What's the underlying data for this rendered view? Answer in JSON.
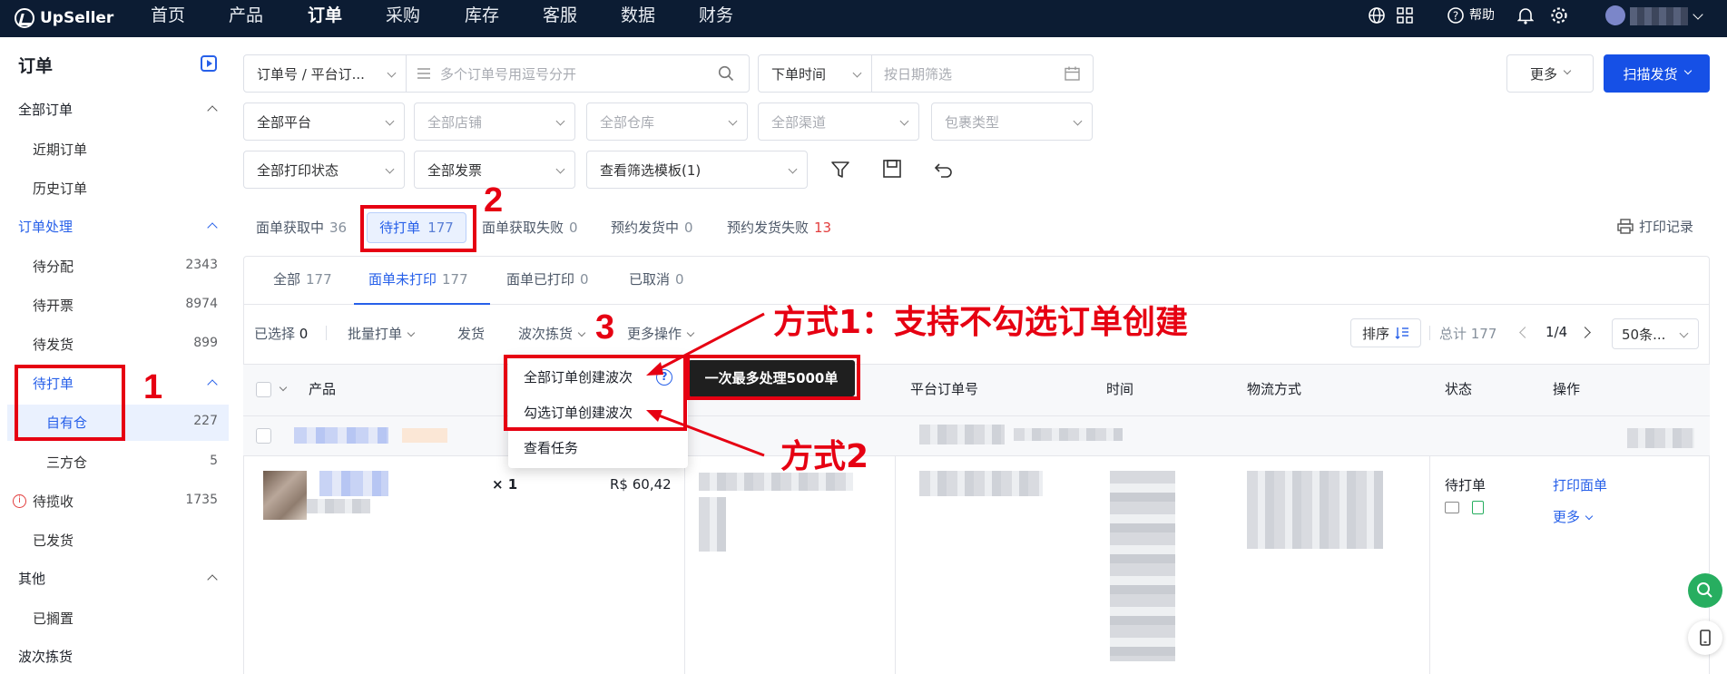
{
  "topnav": {
    "brand": "UpSeller",
    "items": [
      "首页",
      "产品",
      "订单",
      "采购",
      "库存",
      "客服",
      "数据",
      "财务"
    ],
    "help": "帮助"
  },
  "sidebar": {
    "title": "订单",
    "all_orders": "全部订单",
    "recent_orders": "近期订单",
    "history_orders": "历史订单",
    "processing": "订单处理",
    "to_allocate": {
      "label": "待分配",
      "count": "2343"
    },
    "to_invoice": {
      "label": "待开票",
      "count": "8974"
    },
    "to_ship": {
      "label": "待发货",
      "count": "899"
    },
    "to_print": "待打单",
    "own_warehouse": {
      "label": "自有仓",
      "count": "227"
    },
    "third_party": {
      "label": "三方仓",
      "count": "5"
    },
    "to_collect": {
      "label": "待揽收",
      "count": "1735"
    },
    "shipped": "已发货",
    "other": "其他",
    "shelved": "已搁置",
    "wave_picking": "波次拣货"
  },
  "filters": {
    "order_no_select": "订单号 / 平台订...",
    "order_no_placeholder": "多个订单号用逗号分开",
    "time_select": "下单时间",
    "date_placeholder": "按日期筛选",
    "more": "更多",
    "scan_ship": "扫描发货",
    "platform": "全部平台",
    "store": "全部店铺",
    "warehouse": "全部仓库",
    "channel": "全部渠道",
    "package_type": "包裹类型",
    "print_status": "全部打印状态",
    "invoice": "全部发票",
    "filter_template": "查看筛选模板(1)"
  },
  "status_tabs": [
    {
      "label": "面单获取中",
      "count": "36"
    },
    {
      "label": "待打单",
      "count": "177"
    },
    {
      "label": "面单获取失败",
      "count": "0"
    },
    {
      "label": "预约发货中",
      "count": "0"
    },
    {
      "label": "预约发货失败",
      "count": "13"
    }
  ],
  "print_record": "打印记录",
  "sub_tabs": [
    {
      "label": "全部",
      "count": "177"
    },
    {
      "label": "面单未打印",
      "count": "177"
    },
    {
      "label": "面单已打印",
      "count": "0"
    },
    {
      "label": "已取消",
      "count": "0"
    }
  ],
  "toolbar": {
    "selected": "已选择",
    "selected_count": "0",
    "batch_print": "批量打单",
    "ship": "发货",
    "wave": "波次拣货",
    "more_ops": "更多操作",
    "sort": "排序",
    "total": "总计 177",
    "page": "1/4",
    "page_size": "50条..."
  },
  "dropdown": {
    "create_all": "全部订单创建波次",
    "create_selected": "勾选订单创建波次",
    "view_tasks": "查看任务"
  },
  "tooltip": "一次最多处理5000单",
  "table": {
    "headers": [
      "产品",
      "平台订单号",
      "时间",
      "物流方式",
      "状态",
      "操作"
    ],
    "row": {
      "qty": "× 1",
      "price": "R$ 60,42",
      "status": "待打单",
      "print_label": "打印面单",
      "more": "更多"
    }
  },
  "annotations": {
    "n1": "1",
    "n2": "2",
    "n3": "3",
    "method1": "方式1：支持不勾选订单创建",
    "method2": "方式2"
  },
  "colors": {
    "nav_bg": "#0c1c33",
    "primary": "#1650e6",
    "annotation": "#e60012"
  }
}
